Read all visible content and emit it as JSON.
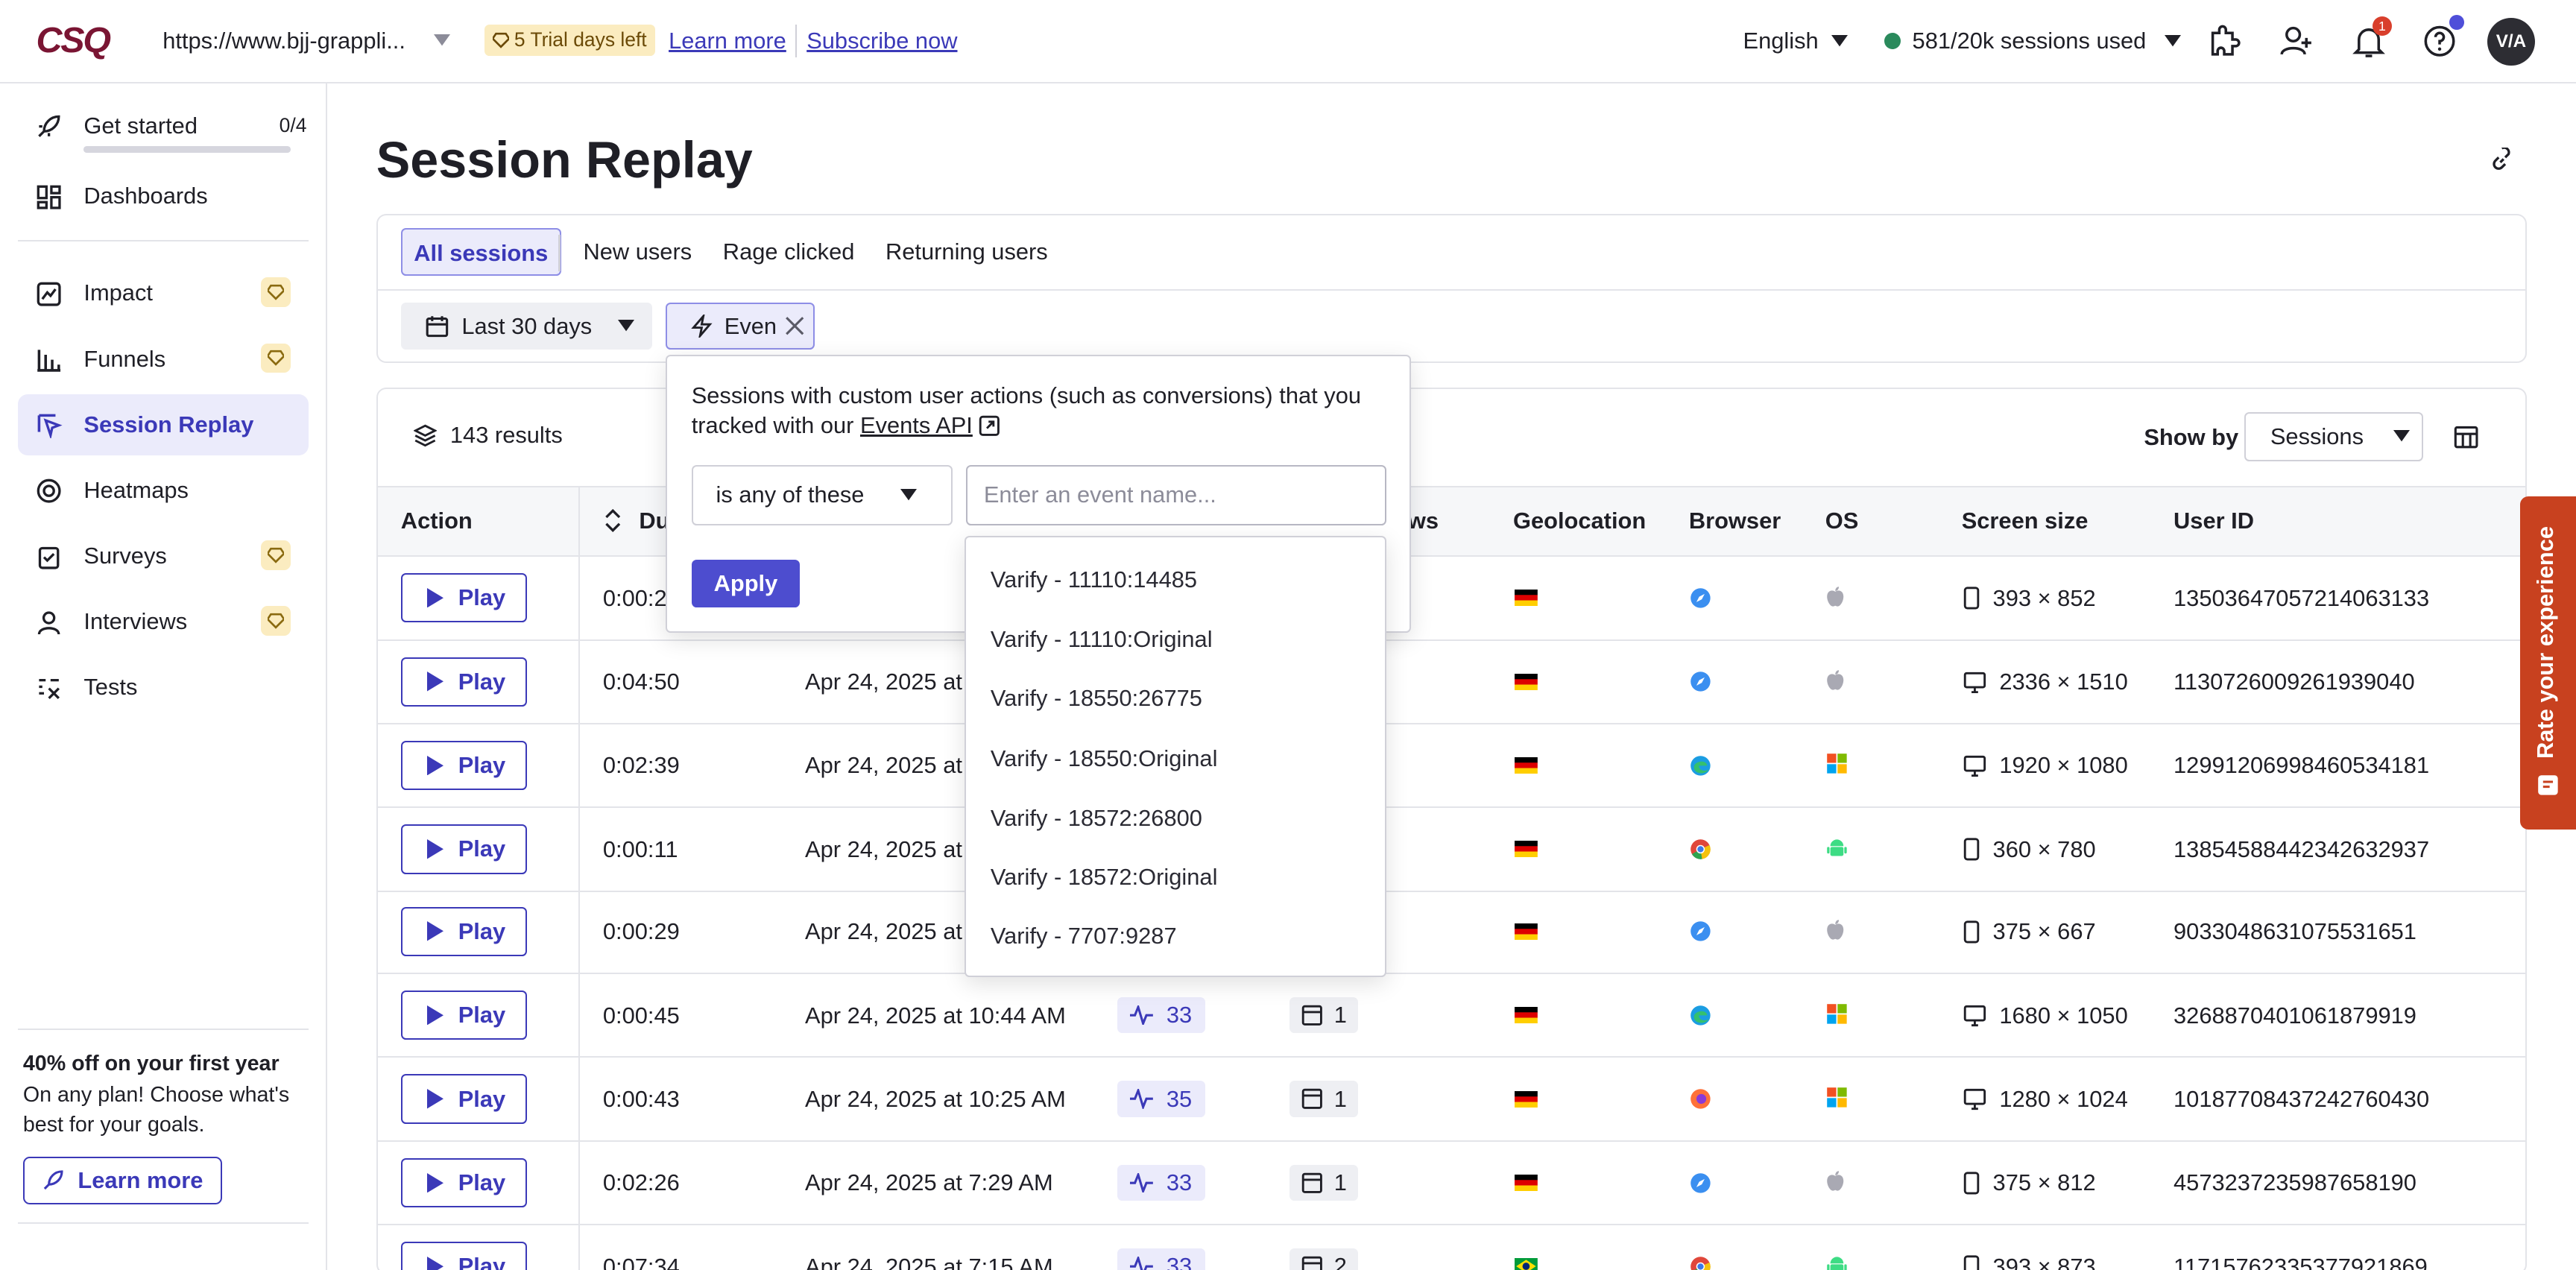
{
  "topbar": {
    "logo": "CSQ",
    "site_url": "https://www.bjj-grappli...",
    "trial_badge": "5 Trial days left",
    "learn_more": "Learn more",
    "subscribe": "Subscribe now",
    "language": "English",
    "sessions_used": "581/20k sessions used",
    "notification_count": "1",
    "avatar_initials": "V/A"
  },
  "sidebar": {
    "get_started": {
      "label": "Get started",
      "progress": "0/4"
    },
    "items": [
      {
        "label": "Dashboards"
      },
      {
        "label": "Impact"
      },
      {
        "label": "Funnels"
      },
      {
        "label": "Session Replay"
      },
      {
        "label": "Heatmaps"
      },
      {
        "label": "Surveys"
      },
      {
        "label": "Interviews"
      },
      {
        "label": "Tests"
      }
    ],
    "promo": {
      "title": "40% off on your first year",
      "description": "On any plan! Choose what's best for your goals.",
      "button": "Learn more"
    }
  },
  "page": {
    "title": "Session Replay",
    "tabs": [
      "All sessions",
      "New users",
      "Rage clicked",
      "Returning users"
    ],
    "date_filter": "Last 30 days",
    "event_filter": "Even",
    "results": "143 results",
    "show_by_label": "Show by",
    "show_by_value": "Sessions"
  },
  "table": {
    "headers": {
      "action": "Action",
      "duration": "Du",
      "pages": "ws",
      "geolocation": "Geolocation",
      "browser": "Browser",
      "os": "OS",
      "screen_size": "Screen size",
      "user_id": "User ID"
    },
    "play_label": "Play",
    "rows": [
      {
        "duration": "0:00:2",
        "date": "",
        "activity": "",
        "pages": "",
        "country": "de",
        "browser": "safari",
        "os": "apple",
        "device": "phone",
        "screen": "393 × 852",
        "user_id": "13503647057214063133"
      },
      {
        "duration": "0:04:50",
        "date": "Apr 24, 2025 at",
        "activity": "",
        "pages": "",
        "country": "de",
        "browser": "safari",
        "os": "apple",
        "device": "desktop",
        "screen": "2336 × 1510",
        "user_id": "1130726009261939040"
      },
      {
        "duration": "0:02:39",
        "date": "Apr 24, 2025 at",
        "activity": "",
        "pages": "",
        "country": "de",
        "browser": "edge",
        "os": "windows",
        "device": "desktop",
        "screen": "1920 × 1080",
        "user_id": "12991206998460534181"
      },
      {
        "duration": "0:00:11",
        "date": "Apr 24, 2025 at",
        "activity": "",
        "pages": "",
        "country": "de",
        "browser": "chrome",
        "os": "android",
        "device": "phone",
        "screen": "360 × 780",
        "user_id": "13854588442342632937"
      },
      {
        "duration": "0:00:29",
        "date": "Apr 24, 2025 at",
        "activity": "",
        "pages": "",
        "country": "de",
        "browser": "safari",
        "os": "apple",
        "device": "phone",
        "screen": "375 × 667",
        "user_id": "9033048631075531651"
      },
      {
        "duration": "0:00:45",
        "date": "Apr 24, 2025 at 10:44 AM",
        "activity": "33",
        "pages": "1",
        "country": "de",
        "browser": "edge",
        "os": "windows",
        "device": "desktop",
        "screen": "1680 × 1050",
        "user_id": "3268870401061879919"
      },
      {
        "duration": "0:00:43",
        "date": "Apr 24, 2025 at 10:25 AM",
        "activity": "35",
        "pages": "1",
        "country": "de",
        "browser": "firefox",
        "os": "windows",
        "device": "desktop",
        "screen": "1280 × 1024",
        "user_id": "10187708437242760430"
      },
      {
        "duration": "0:02:26",
        "date": "Apr 24, 2025 at 7:29 AM",
        "activity": "33",
        "pages": "1",
        "country": "de",
        "browser": "safari",
        "os": "apple",
        "device": "phone",
        "screen": "375 × 812",
        "user_id": "4573237235987658190"
      },
      {
        "duration": "0:07:34",
        "date": "Apr 24, 2025 at 7:15 AM",
        "activity": "33",
        "pages": "2",
        "country": "br",
        "browser": "chrome",
        "os": "android",
        "device": "phone",
        "screen": "393 × 873",
        "user_id": "11715762335377921869"
      }
    ]
  },
  "event_popover": {
    "description_prefix": "Sessions with custom user actions (such as conversions) that you tracked with our ",
    "api_link": "Events API",
    "operator": "is any of these",
    "input_placeholder": "Enter an event name...",
    "apply": "Apply",
    "options": [
      "Varify - 11110:14485",
      "Varify - 11110:Original",
      "Varify - 18550:26775",
      "Varify - 18550:Original",
      "Varify - 18572:26800",
      "Varify - 18572:Original",
      "Varify - 7707:9287"
    ]
  },
  "feedback_tab": "Rate your experience",
  "colors": {
    "accent": "#3b39b8",
    "accent_bg": "#ebebfb",
    "trial_bg": "#fbecc0",
    "feedback": "#c8411f",
    "status_green": "#2a8a5c",
    "alert_red": "#d93f2c"
  }
}
